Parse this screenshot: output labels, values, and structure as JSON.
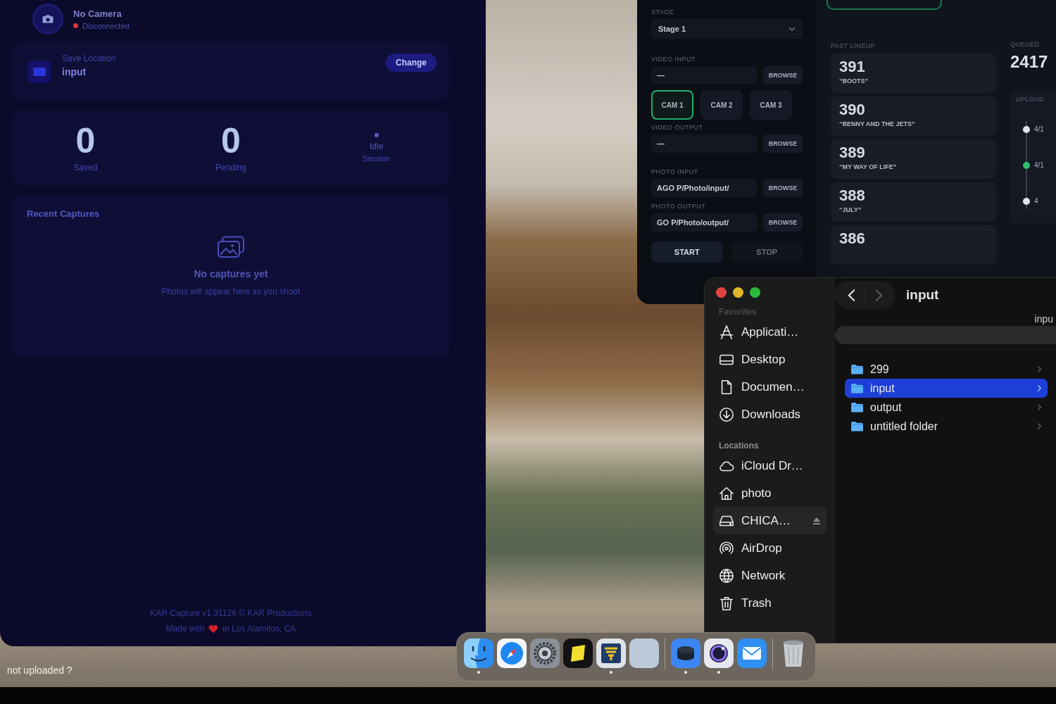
{
  "capture_app": {
    "camera": {
      "title": "No Camera",
      "status": "Disconnected",
      "connected": false
    },
    "save_location": {
      "label": "Save Location",
      "folder": "input",
      "button": "Change"
    },
    "stats": [
      {
        "value": "0",
        "label": "Saved"
      },
      {
        "value": "0",
        "label": "Pending"
      }
    ],
    "session": {
      "status": "Idle",
      "label": "Session"
    },
    "recent": {
      "title": "Recent Captures",
      "empty_title": "No captures yet",
      "empty_hint": "Photos will appear here as you shoot"
    },
    "footer": {
      "credit": "KAR Capture v1.31126 © KAR Productions",
      "made_with": "Made with",
      "place": "in Los Alamitos, CA"
    }
  },
  "desktop_note": "not uploaded ?",
  "stage_app": {
    "stage": {
      "label": "STAGE",
      "value": "Stage 1"
    },
    "video_input": {
      "label": "VIDEO INPUT",
      "value": "—",
      "button": "BROWSE"
    },
    "cameras": [
      {
        "label": "CAM 1",
        "selected": true
      },
      {
        "label": "CAM 2",
        "selected": false
      },
      {
        "label": "CAM 3",
        "selected": false
      }
    ],
    "video_output": {
      "label": "VIDEO OUTPUT",
      "value": "—",
      "button": "BROWSE"
    },
    "photo_input": {
      "label": "PHOTO INPUT",
      "value": "AGO P/Photo/input/",
      "button": "BROWSE"
    },
    "photo_output": {
      "label": "PHOTO OUTPUT",
      "value": "GO P/Photo/output/",
      "button": "BROWSE"
    },
    "buttons": [
      "START",
      "STOP"
    ],
    "lineup": {
      "title": "PAST LINEUP",
      "items": [
        {
          "number": "391",
          "song": "“BOOTS”"
        },
        {
          "number": "390",
          "song": "“BENNY AND THE JETS”"
        },
        {
          "number": "389",
          "song": "“MY WAY OF LIFE”"
        },
        {
          "number": "388",
          "song": "“JULY”"
        },
        {
          "number": "386"
        }
      ]
    },
    "queued": {
      "label": "QUEUED",
      "value": "2417"
    },
    "upload": {
      "title": "UPLOAD",
      "events": [
        {
          "text": "4/1",
          "color": "#dfe3ea"
        },
        {
          "text": "4/1",
          "color": "#2fbf6f"
        },
        {
          "text": "4",
          "color": "#dfe3ea"
        }
      ]
    }
  },
  "finder": {
    "title": "input",
    "header": "inpu",
    "sidebar": [
      {
        "heading": "Favorites",
        "items": [
          {
            "label": "Applicati…",
            "kind": "applications",
            "selected": false
          },
          {
            "label": "Desktop",
            "kind": "desktop",
            "selected": false
          },
          {
            "label": "Documen…",
            "kind": "documents",
            "selected": false
          },
          {
            "label": "Downloads",
            "kind": "downloads",
            "selected": false
          }
        ]
      },
      {
        "heading": "Locations",
        "items": [
          {
            "label": "iCloud Dr…",
            "kind": "icloud",
            "selected": false,
            "ejectable": false
          },
          {
            "label": "photo",
            "kind": "home",
            "selected": false,
            "ejectable": false
          },
          {
            "label": "CHICA…",
            "kind": "drive",
            "selected": true,
            "ejectable": true
          },
          {
            "label": "AirDrop",
            "kind": "airdrop",
            "selected": false,
            "ejectable": false
          },
          {
            "label": "Network",
            "kind": "network",
            "selected": false,
            "ejectable": false
          },
          {
            "label": "Trash",
            "kind": "trash",
            "selected": false,
            "ejectable": false
          }
        ]
      }
    ],
    "files": [
      {
        "name": "299",
        "selected": false
      },
      {
        "name": "input",
        "selected": true
      },
      {
        "name": "output",
        "selected": false
      },
      {
        "name": "untitled folder",
        "selected": false
      }
    ]
  },
  "dock": {
    "groups": [
      {
        "items": [
          {
            "kind": "finder",
            "running": true
          },
          {
            "kind": "safari",
            "running": false
          },
          {
            "kind": "settings",
            "running": false
          },
          {
            "kind": "yellow",
            "running": false
          },
          {
            "kind": "striped",
            "running": true
          },
          {
            "kind": "blank",
            "running": false
          }
        ]
      },
      {
        "items": [
          {
            "kind": "puck",
            "running": true
          },
          {
            "kind": "ring",
            "running": true
          },
          {
            "kind": "mail",
            "running": false
          }
        ]
      },
      {
        "items": [
          {
            "kind": "trash",
            "running": false
          }
        ]
      }
    ]
  }
}
